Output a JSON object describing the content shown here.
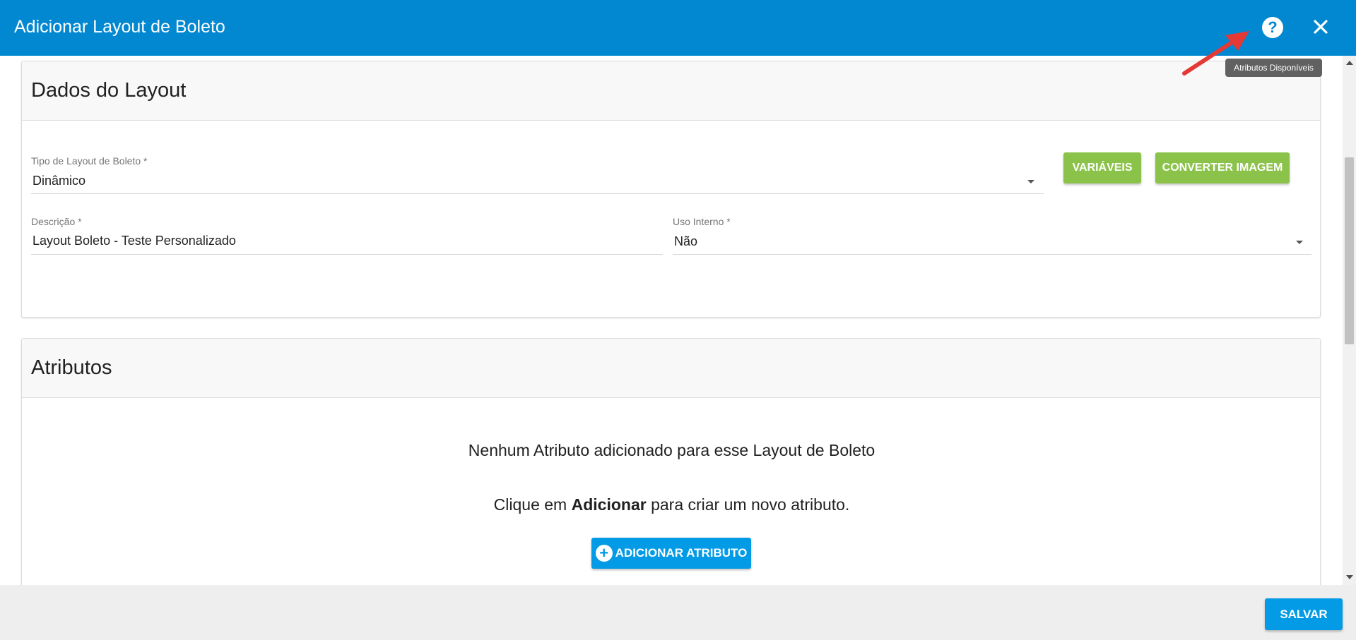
{
  "header": {
    "title": "Adicionar Layout de Boleto",
    "help_symbol": "?",
    "tooltip": "Atributos Disponíveis"
  },
  "dados": {
    "title": "Dados do Layout",
    "tipo_label": "Tipo de Layout de Boleto *",
    "tipo_value": "Dinâmico",
    "variaveis_button": "VARIÁVEIS",
    "converter_button": "CONVERTER IMAGEM",
    "descricao_label": "Descrição *",
    "descricao_value": "Layout Boleto - Teste Personalizado",
    "uso_label": "Uso Interno *",
    "uso_value": "Não"
  },
  "atributos": {
    "title": "Atributos",
    "empty_line1": "Nenhum Atributo adicionado para esse Layout de Boleto",
    "empty_line2_prefix": "Clique em ",
    "empty_line2_bold": "Adicionar",
    "empty_line2_suffix": " para criar um novo atributo.",
    "add_button": "ADICIONAR ATRIBUTO"
  },
  "footer": {
    "save_button": "SALVAR"
  },
  "colors": {
    "primary": "#0288d1",
    "accent": "#039be5",
    "green": "#8bc34a",
    "annotation_arrow": "#e53935"
  },
  "icons": {
    "help": "help-circle-icon",
    "close": "close-icon",
    "dropdown": "caret-down-icon",
    "add": "plus-circle-icon"
  }
}
